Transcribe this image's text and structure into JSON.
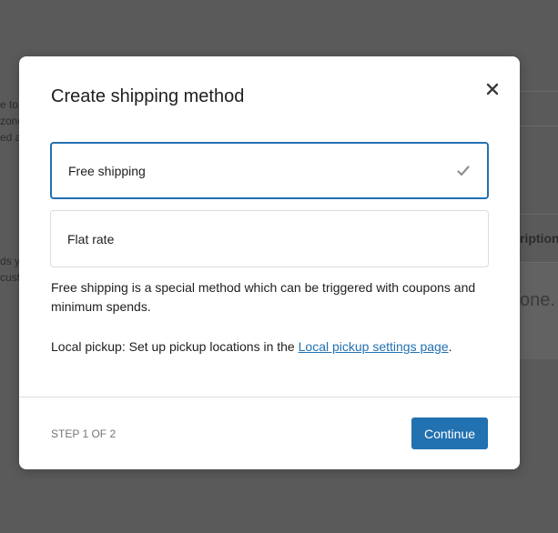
{
  "background": {
    "fragments": [
      "e to",
      "zone",
      "ed a",
      "ds y",
      "cust"
    ],
    "column_header_fragment": "ription",
    "empty_text_fragment": "one. C"
  },
  "modal": {
    "title": "Create shipping method",
    "close_icon": "close-icon",
    "options": [
      {
        "label": "Free shipping",
        "selected": true,
        "indicator_icon": "checkmark-icon"
      },
      {
        "label": "Flat rate",
        "selected": false
      }
    ],
    "description": "Free shipping is a special method which can be triggered with coupons and minimum spends.",
    "local_pickup": {
      "prefix": "Local pickup: Set up pickup locations in the ",
      "link_text": "Local pickup settings page",
      "suffix": "."
    },
    "footer": {
      "step": "STEP 1 OF 2",
      "continue_label": "Continue"
    }
  },
  "colors": {
    "accent": "#2271b1",
    "overlay": "#5a5a5a",
    "text": "#1e1e1e",
    "muted": "#757575"
  }
}
